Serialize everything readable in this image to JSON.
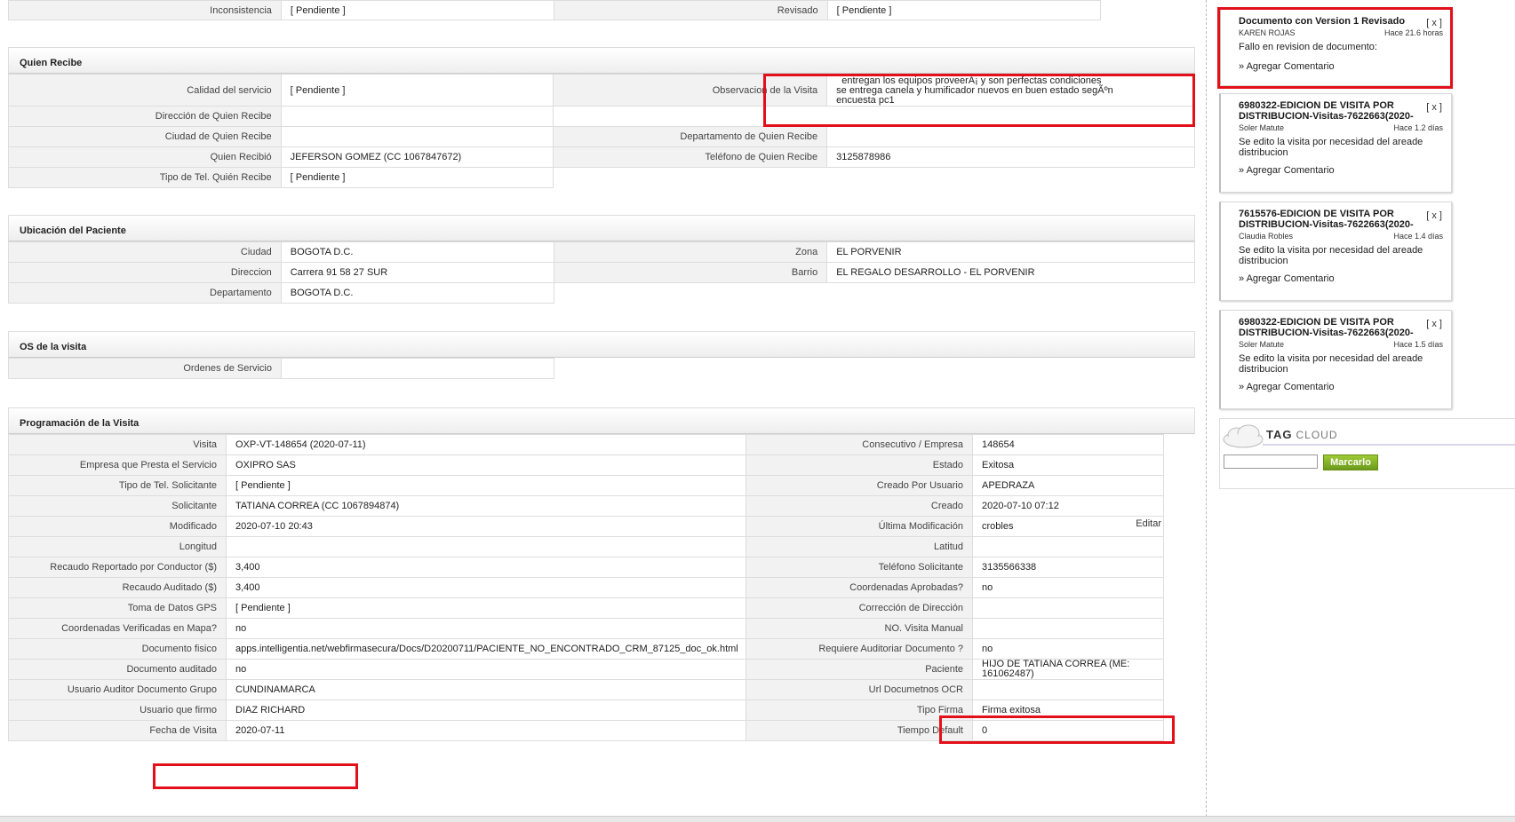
{
  "top_row": {
    "inconsistencia_label": "Inconsistencia",
    "inconsistencia_value": "[ Pendiente ]",
    "revisado_label": "Revisado",
    "revisado_value": "[ Pendiente ]"
  },
  "quien_recibe": {
    "header": "Quien Recibe",
    "calidad_label": "Calidad del servicio",
    "calidad_value": "[ Pendiente ]",
    "observacion_label": "Observacion de la Visita",
    "observacion_line1": "  entregan los equipos proveerÃ¡ y son perfectas condiciones",
    "observacion_line2": "se entrega canela y humificador nuevos en buen estado segÃºn",
    "observacion_line3": "encuesta pc1",
    "direccion_label": "Dirección de Quien Recibe",
    "direccion_value": "",
    "ciudad_label": "Ciudad de Quien Recibe",
    "ciudad_value": "",
    "departamento_label": "Departamento de Quien Recibe",
    "departamento_value": "",
    "quien_recibio_label": "Quien Recibió",
    "quien_recibio_value": "JEFERSON GOMEZ (CC 1067847672)",
    "telefono_label": "Teléfono de Quien Recibe",
    "telefono_value": "3125878986",
    "tipo_tel_label": "Tipo de Tel. Quién Recibe",
    "tipo_tel_value": "[ Pendiente ]"
  },
  "ubicacion": {
    "header": "Ubicación del Paciente",
    "ciudad_label": "Ciudad",
    "ciudad_value": "BOGOTA D.C.",
    "zona_label": "Zona",
    "zona_value": "EL PORVENIR",
    "direccion_label": "Direccion",
    "direccion_value": "Carrera 91 58 27 SUR",
    "barrio_label": "Barrio",
    "barrio_value": "EL REGALO DESARROLLO - EL PORVENIR",
    "departamento_label": "Departamento",
    "departamento_value": "BOGOTA D.C."
  },
  "os_visita": {
    "header": "OS de la visita",
    "ordenes_label": "Ordenes de Servicio",
    "ordenes_value": ""
  },
  "programacion": {
    "header": "Programación de la Visita",
    "edit_label": "Editar",
    "rows": [
      {
        "l1": "Visita",
        "v1": "OXP-VT-148654 (2020-07-11)",
        "l2": "Consecutivo / Empresa",
        "v2": "148654"
      },
      {
        "l1": "Empresa que Presta el Servicio",
        "v1": "OXIPRO SAS",
        "l2": "Estado",
        "v2": "Exitosa"
      },
      {
        "l1": "Tipo de Tel. Solicitante",
        "v1": "[ Pendiente ]",
        "l2": "Creado Por Usuario",
        "v2": "APEDRAZA"
      },
      {
        "l1": "Solicitante",
        "v1": "TATIANA CORREA (CC 1067894874)",
        "l2": "Creado",
        "v2": "2020-07-10 07:12"
      },
      {
        "l1": "Modificado",
        "v1": "2020-07-10 20:43",
        "l2": "Última Modificación",
        "v2": " crobles"
      },
      {
        "l1": "Longitud",
        "v1": "",
        "l2": "Latitud",
        "v2": ""
      },
      {
        "l1": "Recaudo Reportado por Conductor ($)",
        "v1": "3,400",
        "l2": "Teléfono Solicitante",
        "v2": "3135566338"
      },
      {
        "l1": "Recaudo Auditado ($)",
        "v1": "3,400",
        "l2": "Coordenadas Aprobadas?",
        "v2": " no"
      },
      {
        "l1": "Toma de Datos GPS",
        "v1": "[ Pendiente ]",
        "l2": "Corrección de Dirección",
        "v2": ""
      },
      {
        "l1": "Coordenadas Verificadas en Mapa?",
        "v1": " no",
        "l2": "NO. Visita Manual",
        "v2": ""
      },
      {
        "l1": "Documento fisico",
        "v1": " apps.intelligentia.net/webfirmasecura/Docs/D20200711/PACIENTE_NO_ENCONTRADO_CRM_87125_doc_ok.html",
        "l2": "Requiere Auditoriar Documento ?",
        "v2": " no"
      },
      {
        "l1": "Documento auditado",
        "v1": " no",
        "l2": "Paciente",
        "v2": "HIJO DE TATIANA CORREA (ME: 161062487)"
      },
      {
        "l1": "Usuario Auditor Documento Grupo",
        "v1": "CUNDINAMARCA",
        "l2": "Url Documetnos OCR",
        "v2": ""
      },
      {
        "l1": "Usuario que firmo",
        "v1": "DIAZ RICHARD",
        "l2": "Tipo Firma",
        "v2": "Firma exitosa"
      },
      {
        "l1": "Fecha de Visita",
        "v1": " 2020-07-11",
        "l2": "Tiempo Default",
        "v2": "0"
      }
    ]
  },
  "sidebar": {
    "cards": [
      {
        "title": "Documento con Version 1 Revisado",
        "close": "[ x ]",
        "author": "KAREN ROJAS",
        "time": "Hace 21.6 horas",
        "body": "Fallo en revision de documento:",
        "link": "» Agregar Comentario"
      },
      {
        "title": "6980322-EDICION DE VISITA POR DISTRIBUCION-Visitas-7622663(2020-",
        "close": "[ x ]",
        "author": "Soler Matute",
        "time": "Hace 1.2 días",
        "body": "Se edito la visita por necesidad del areade distribucion",
        "link": "» Agregar Comentario"
      },
      {
        "title": "7615576-EDICION DE VISITA POR DISTRIBUCION-Visitas-7622663(2020-",
        "close": "[ x ]",
        "author": "Claudia Robles",
        "time": "Hace 1.4 días",
        "body": "Se edito la visita por necesidad del areade distribucion",
        "link": "» Agregar Comentario"
      },
      {
        "title": "6980322-EDICION DE VISITA POR DISTRIBUCION-Visitas-7622663(2020-",
        "close": "[ x ]",
        "author": "Soler Matute",
        "time": "Hace 1.5 días",
        "body": "Se edito la visita por necesidad del areade distribucion",
        "link": "» Agregar Comentario"
      }
    ],
    "tagcloud": {
      "title_tag": "TAG",
      "title_cloud": "CLOUD",
      "button_label": "Marcarlo",
      "input_value": ""
    }
  },
  "colors": {
    "highlight": "#e3101a",
    "button": "#7aa825"
  }
}
